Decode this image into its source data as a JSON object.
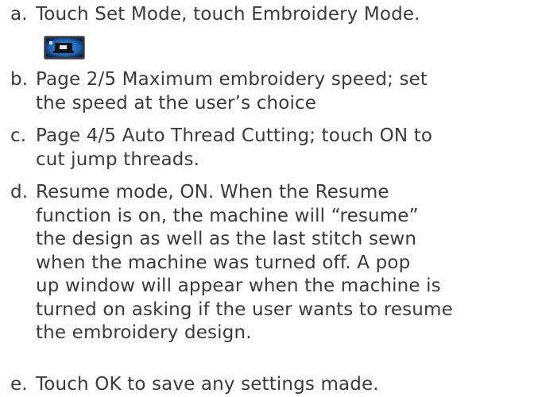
{
  "icon": {
    "name": "embroidery-mode-icon",
    "colors": {
      "frame_outer": "#3a3a3a",
      "frame_inner": "#0d2a57",
      "glow": "#2f8fe0",
      "body": "#1a1a1a",
      "screen": "#e8ecf0"
    }
  },
  "text_color": "#3a3a3a",
  "items": [
    {
      "marker": "a.",
      "lines": [
        "Touch Set Mode, touch Embroidery Mode."
      ]
    },
    {
      "marker": "b.",
      "lines": [
        "Page 2/5 Maximum embroidery speed; set",
        "the speed at the user’s choice"
      ]
    },
    {
      "marker": "c.",
      "lines": [
        "Page 4/5 Auto Thread Cutting; touch ON to",
        "cut jump threads."
      ]
    },
    {
      "marker": "d.",
      "lines": [
        "Resume mode, ON.  When the Resume",
        "function is on, the machine will “resume”",
        "the design as well as the last stitch sewn",
        "when the machine was turned off.  A pop",
        "up window will appear when the machine is",
        "turned on asking if the user wants to resume",
        "the embroidery design."
      ]
    },
    {
      "marker": "e.",
      "lines": [
        "Touch OK to save any settings made."
      ]
    }
  ]
}
